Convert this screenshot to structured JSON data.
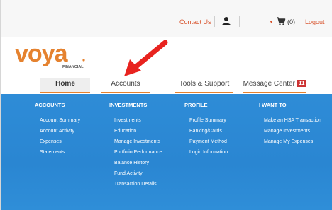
{
  "topbar": {
    "contact_label": "Contact Us",
    "cart_count": "(0)",
    "logout_label": "Logout"
  },
  "logo": {
    "wordmark": "voya",
    "subtitle": "FINANCIAL"
  },
  "nav": {
    "tabs": [
      {
        "label": "Home"
      },
      {
        "label": "Accounts"
      },
      {
        "label": "Tools & Support"
      },
      {
        "label": "Message Center",
        "badge": "11"
      }
    ]
  },
  "menu": {
    "accounts": {
      "heading": "ACCOUNTS",
      "links": [
        "Account Summary",
        "Account Activity",
        "Expenses",
        "Statements"
      ]
    },
    "investments": {
      "heading": "INVESTMENTS",
      "links": [
        "Investments",
        "Education",
        "Manage Investments",
        "Portfolio Performance",
        "Balance History",
        "Fund Activity",
        "Transaction Details"
      ]
    },
    "profile": {
      "heading": "PROFILE",
      "links": [
        "Profile Summary",
        "Banking/Cards",
        "Payment Method",
        "Login Information"
      ]
    },
    "iwantto": {
      "heading": "I WANT TO",
      "links": [
        "Make an HSA Transaction",
        "Manage Investments",
        "Manage My Expenses"
      ]
    }
  },
  "colors": {
    "brand_orange": "#e5822f",
    "menu_blue": "#2a86d2",
    "link_orange": "#d8522b",
    "badge_red": "#cc3333",
    "arrow_red": "#e8231f"
  }
}
